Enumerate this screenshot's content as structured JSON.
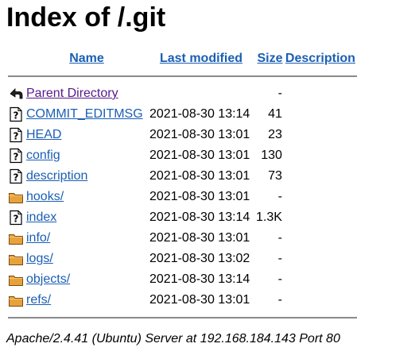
{
  "page": {
    "title": "Index of /.git"
  },
  "columns": {
    "name": "Name",
    "last_modified": "Last modified",
    "size": "Size",
    "description": "Description"
  },
  "entries": [
    {
      "icon": "back-arrow-icon",
      "name": "Parent Directory",
      "modified": "",
      "size": "-",
      "kind": "parent"
    },
    {
      "icon": "unknown-file-icon",
      "name": "COMMIT_EDITMSG",
      "modified": "2021-08-30 13:14",
      "size": "41",
      "kind": "file"
    },
    {
      "icon": "unknown-file-icon",
      "name": "HEAD",
      "modified": "2021-08-30 13:01",
      "size": "23",
      "kind": "file"
    },
    {
      "icon": "unknown-file-icon",
      "name": "config",
      "modified": "2021-08-30 13:01",
      "size": "130",
      "kind": "file"
    },
    {
      "icon": "unknown-file-icon",
      "name": "description",
      "modified": "2021-08-30 13:01",
      "size": "73",
      "kind": "file"
    },
    {
      "icon": "folder-icon",
      "name": "hooks/",
      "modified": "2021-08-30 13:01",
      "size": "-",
      "kind": "folder"
    },
    {
      "icon": "unknown-file-icon",
      "name": "index",
      "modified": "2021-08-30 13:14",
      "size": "1.3K",
      "kind": "file"
    },
    {
      "icon": "folder-icon",
      "name": "info/",
      "modified": "2021-08-30 13:01",
      "size": "-",
      "kind": "folder"
    },
    {
      "icon": "folder-icon",
      "name": "logs/",
      "modified": "2021-08-30 13:02",
      "size": "-",
      "kind": "folder"
    },
    {
      "icon": "folder-icon",
      "name": "objects/",
      "modified": "2021-08-30 13:14",
      "size": "-",
      "kind": "folder"
    },
    {
      "icon": "folder-icon",
      "name": "refs/",
      "modified": "2021-08-30 13:01",
      "size": "-",
      "kind": "folder"
    }
  ],
  "footer": {
    "text": "Apache/2.4.41 (Ubuntu) Server at 192.168.184.143 Port 80"
  },
  "colors": {
    "link": "#1a5fb4",
    "visited_link": "#551a8b",
    "rule": "#8a8a8a",
    "folder_fill": "#e8a23a"
  }
}
